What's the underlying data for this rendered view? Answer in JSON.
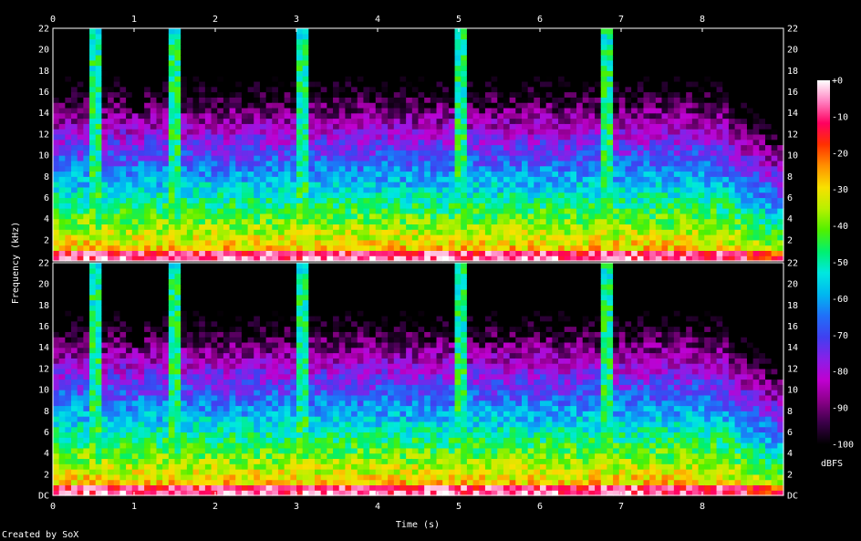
{
  "chart_data": {
    "type": "heatmap",
    "title": "",
    "xlabel": "Time (s)",
    "ylabel": "Frequency (kHz)",
    "x_ticks": [
      "0",
      "1",
      "2",
      "3",
      "4",
      "5",
      "6",
      "7",
      "8"
    ],
    "xlim": [
      0,
      9.0
    ],
    "channels": [
      {
        "y_ticks": [
          "22",
          "20",
          "18",
          "16",
          "14",
          "12",
          "10",
          "8",
          "6",
          "4",
          "2"
        ],
        "ylim": [
          0,
          22
        ]
      },
      {
        "y_ticks": [
          "22",
          "20",
          "18",
          "16",
          "14",
          "12",
          "10",
          "8",
          "6",
          "4",
          "2",
          "DC"
        ],
        "ylim": [
          0,
          22
        ]
      }
    ],
    "colorbar": {
      "label": "dBFS",
      "ticks": [
        "+0",
        "-10",
        "-20",
        "-30",
        "-40",
        "-50",
        "-60",
        "-70",
        "-80",
        "-90",
        "-100"
      ],
      "range": [
        -100,
        0
      ],
      "colors": [
        "#000000",
        "#3a0048",
        "#8a0088",
        "#c000d0",
        "#8820e8",
        "#4040f0",
        "#2070f8",
        "#00b8f0",
        "#00e8e0",
        "#00f070",
        "#50f000",
        "#b8f000",
        "#f8e000",
        "#ff9000",
        "#ff3000",
        "#ff0060",
        "#ff80c0",
        "#ffffff"
      ]
    },
    "transients_s": [
      0.52,
      1.52,
      3.05,
      5.0,
      6.85
    ],
    "footer": "Created by SoX"
  }
}
